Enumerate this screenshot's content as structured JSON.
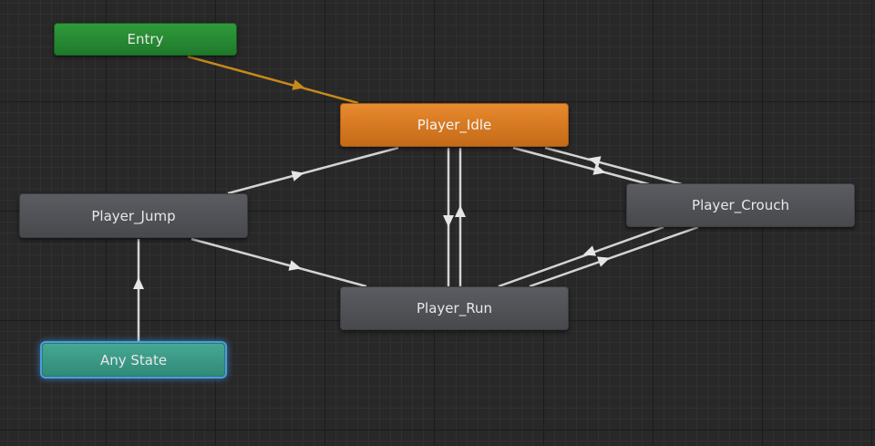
{
  "graph": {
    "nodes": {
      "entry": {
        "label": "Entry",
        "color": "#248a33"
      },
      "player_idle": {
        "label": "Player_Idle",
        "color": "#d97a22",
        "is_default": true
      },
      "player_jump": {
        "label": "Player_Jump",
        "color": "#505257"
      },
      "player_crouch": {
        "label": "Player_Crouch",
        "color": "#505257"
      },
      "player_run": {
        "label": "Player_Run",
        "color": "#505257"
      },
      "any_state": {
        "label": "Any State",
        "color": "#3a9a86",
        "selected": true
      }
    },
    "transitions": [
      {
        "from": "entry",
        "to": "player_idle",
        "color": "#c78a1a"
      },
      {
        "from": "player_jump",
        "to": "player_idle",
        "color": "#d4d4d4"
      },
      {
        "from": "player_jump",
        "to": "player_run",
        "color": "#d4d4d4"
      },
      {
        "from": "any_state",
        "to": "player_jump",
        "color": "#d4d4d4"
      },
      {
        "from": "player_idle",
        "to": "player_run",
        "color": "#d4d4d4"
      },
      {
        "from": "player_run",
        "to": "player_idle",
        "color": "#d4d4d4"
      },
      {
        "from": "player_idle",
        "to": "player_crouch",
        "color": "#d4d4d4"
      },
      {
        "from": "player_crouch",
        "to": "player_idle",
        "color": "#d4d4d4"
      },
      {
        "from": "player_run",
        "to": "player_crouch",
        "color": "#d4d4d4"
      },
      {
        "from": "player_crouch",
        "to": "player_run",
        "color": "#d4d4d4"
      }
    ]
  }
}
